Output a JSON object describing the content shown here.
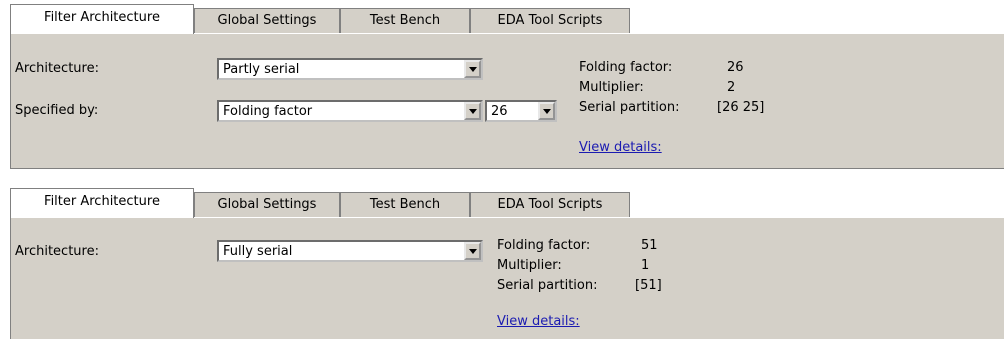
{
  "panel1": {
    "tabs": [
      {
        "label": "Filter Architecture"
      },
      {
        "label": "Global Settings"
      },
      {
        "label": "Test Bench"
      },
      {
        "label": "EDA Tool Scripts"
      }
    ],
    "architecture_label": "Architecture:",
    "architecture_value": "Partly serial",
    "specified_by_label": "Specified by:",
    "specified_by_value": "Folding factor",
    "folding_select_value": "26",
    "info": {
      "folding_factor_label": "Folding factor:",
      "folding_factor_value": "26",
      "multiplier_label": "Multiplier:",
      "multiplier_value": "2",
      "serial_partition_label": "Serial partition:",
      "serial_partition_value": "[26 25]"
    },
    "view_details": "View details:"
  },
  "panel2": {
    "tabs": [
      {
        "label": "Filter Architecture"
      },
      {
        "label": "Global Settings"
      },
      {
        "label": "Test Bench"
      },
      {
        "label": "EDA Tool Scripts"
      }
    ],
    "architecture_label": "Architecture:",
    "architecture_value": "Fully serial",
    "info": {
      "folding_factor_label": "Folding factor:",
      "folding_factor_value": "51",
      "multiplier_label": "Multiplier:",
      "multiplier_value": "1",
      "serial_partition_label": "Serial partition:",
      "serial_partition_value": "[51]"
    },
    "view_details": "View details:"
  }
}
